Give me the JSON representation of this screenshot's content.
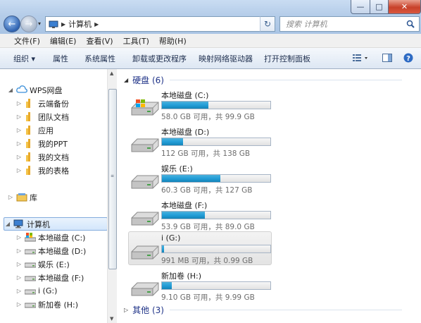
{
  "window": {
    "controls": {
      "minimize": "—",
      "maximize": "□",
      "close": "✕"
    }
  },
  "address": {
    "crumb": "计算机",
    "refresh": "↻"
  },
  "search": {
    "placeholder": "搜索 计算机"
  },
  "menu": [
    "文件(F)",
    "编辑(E)",
    "查看(V)",
    "工具(T)",
    "帮助(H)"
  ],
  "toolbar": {
    "organize": "组织 ▾",
    "b1": "属性",
    "b2": "系统属性",
    "b3": "卸载或更改程序",
    "b4": "映射网络驱动器",
    "b5": "打开控制面板"
  },
  "nav": {
    "wps": "WPS网盘",
    "wps_items": [
      "云端备份",
      "团队文档",
      "应用",
      "我的PPT",
      "我的文档",
      "我的表格"
    ],
    "library": "库",
    "computer": "计算机",
    "drives": [
      "本地磁盘 (C:)",
      "本地磁盘 (D:)",
      "娱乐 (E:)",
      "本地磁盘 (F:)",
      "i (G:)",
      "新加卷 (H:)"
    ]
  },
  "content": {
    "hdd_group": "硬盘 (6)",
    "other_group": "其他 (3)",
    "drives": [
      {
        "name": "本地磁盘 (C:)",
        "info": "58.0 GB 可用，共 99.9 GB",
        "used_fraction": 0.42
      },
      {
        "name": "本地磁盘 (D:)",
        "info": "112 GB 可用，共 138 GB",
        "used_fraction": 0.19
      },
      {
        "name": "娱乐 (E:)",
        "info": "60.3 GB 可用，共 127 GB",
        "used_fraction": 0.53
      },
      {
        "name": "本地磁盘 (F:)",
        "info": "53.9 GB 可用，共 89.0 GB",
        "used_fraction": 0.39
      },
      {
        "name": "i (G:)",
        "info": "991 MB 可用，共 0.99 GB",
        "used_fraction": 0.02
      },
      {
        "name": "新加卷 (H:)",
        "info": "9.10 GB 可用，共 9.99 GB",
        "used_fraction": 0.09
      }
    ]
  },
  "colors": {
    "bar_fill": "#26a0da",
    "group_header": "#1e3287"
  }
}
